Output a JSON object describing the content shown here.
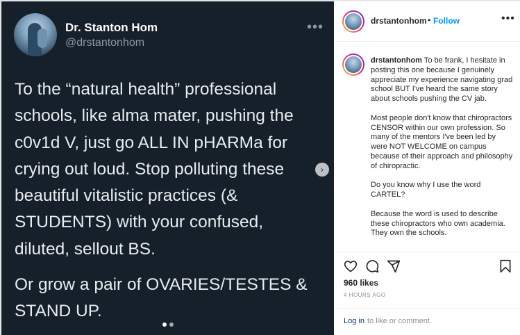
{
  "tweet": {
    "author_name": "Dr. Stanton Hom",
    "author_handle": "@drstantonhom",
    "more_label": "•••",
    "body_lines": [
      "To the “natural health” professional",
      "schools, like alma mater, pushing the",
      "c0v1d V, just go ALL IN pHARMa for",
      "crying out loud. Stop polluting these",
      "beautiful vitalistic practices (&",
      "STUDENTS) with your confused,",
      "diluted, sellout BS."
    ],
    "body2_lines": [
      "Or grow a pair of OVARIES/TESTES &",
      "STAND UP."
    ],
    "background": "#15202b"
  },
  "carousel": {
    "next_icon": "chevron-right-icon",
    "next_glyph": "›",
    "slide_count": 2,
    "current_slide": 1
  },
  "header": {
    "username": "drstantonhom",
    "separator": "•",
    "follow_label": "Follow",
    "more_label": "•••",
    "follow_color": "#0095f6"
  },
  "caption": {
    "username": "drstantonhom",
    "paragraphs": [
      "To be frank, I hesitate in posting this one because I genuinely appreciate my experience navigating grad school BUT I've heard the same story about schools pushing the CV jab.",
      "Most people don't know that chiropractors CENSOR within our own profession. So many of the mentors I've been led by were NOT WELCOME on campus because of their approach and philosophy of chiropractic.",
      "Do you know why I use the word CARTEL?",
      "Because the word is used to describe these chiropractors who own academia. They own the schools."
    ]
  },
  "actions": {
    "icons": [
      "heart-icon",
      "comment-icon",
      "share-icon",
      "bookmark-icon"
    ],
    "likes": "960 likes",
    "time": "4 HOURS AGO"
  },
  "comment": {
    "login_label": "Log in",
    "rest_label": "to like or comment."
  }
}
